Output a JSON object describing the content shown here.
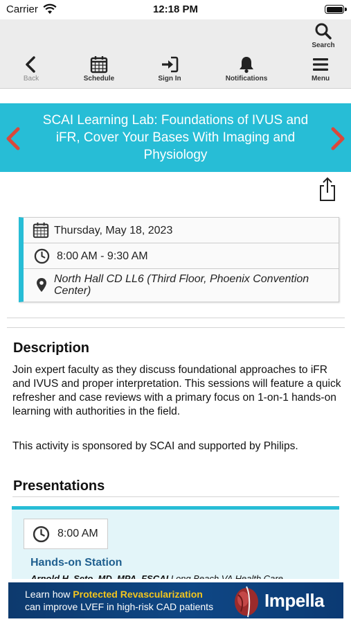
{
  "status_bar": {
    "carrier": "Carrier",
    "time": "12:18 PM"
  },
  "navbar": {
    "search_label": "Search",
    "back_label": "Back",
    "schedule_label": "Schedule",
    "signin_label": "Sign In",
    "notifications_label": "Notifications",
    "menu_label": "Menu"
  },
  "session": {
    "title": "SCAI Learning Lab: Foundations of IVUS and iFR, Cover Your Bases With Imaging and Physiology",
    "date": "Thursday, May 18, 2023",
    "time": "8:00 AM - 9:30 AM",
    "location": "North Hall CD LL6 (Third Floor, Phoenix Convention Center)"
  },
  "description": {
    "heading": "Description",
    "body": "Join expert faculty as they discuss foundational approaches to iFR and IVUS and proper interpretation. This sessions will feature a quick refresher and case reviews with a primary focus on 1-on-1 hands-on learning with authorities in the field.",
    "sponsor": "This activity is sponsored by SCAI and supported by Philips."
  },
  "presentations": {
    "heading": "Presentations",
    "items": [
      {
        "time": "8:00 AM",
        "title": "Hands-on Station",
        "speaker": "Arnold H. Seto, MD, MPA, FSCAI",
        "affiliation": "Long Beach VA Health Care"
      }
    ]
  },
  "ad": {
    "line1_prefix": "Learn how ",
    "line1_highlight": "Protected Revascularization",
    "line2": "can improve LVEF in high-risk CAD patients",
    "brand": "Impella"
  },
  "colors": {
    "accent": "#27bdd6",
    "arrow": "#d9483b",
    "link": "#1f5f8f",
    "ad_bg": "#0f4785",
    "ad_highlight": "#f3c51e"
  },
  "icons": [
    "wifi-icon",
    "battery-icon",
    "search-icon",
    "back-icon",
    "calendar-icon",
    "sign-in-icon",
    "bell-icon",
    "menu-icon",
    "chevron-left-icon",
    "chevron-right-icon",
    "share-icon",
    "clock-icon",
    "location-pin-icon"
  ]
}
